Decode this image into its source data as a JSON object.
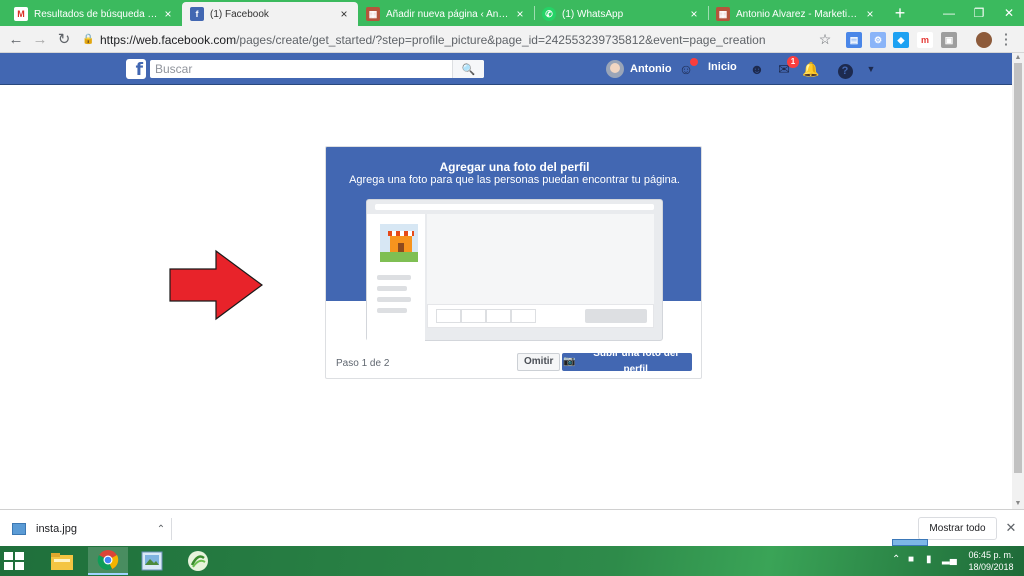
{
  "browser": {
    "tabs": [
      {
        "title": "Resultados de búsqueda - antonio",
        "favicon": "gmail-icon",
        "active": false
      },
      {
        "title": "(1) Facebook",
        "favicon": "facebook-icon",
        "active": true
      },
      {
        "title": "Añadir nueva página ‹ Antonio A",
        "favicon": "wordpress-icon",
        "active": false
      },
      {
        "title": "(1) WhatsApp",
        "favicon": "whatsapp-icon",
        "active": false
      },
      {
        "title": "Antonio Alvarez - Marketing Dig",
        "favicon": "site-icon",
        "active": false
      }
    ],
    "close_glyph": "×",
    "new_tab_glyph": "+",
    "address": {
      "domain": "https://web.facebook.com",
      "path": "/pages/create/get_started/?step=profile_picture&page_id=242553239735812&event=page_creation"
    }
  },
  "facebook": {
    "logo": "f",
    "search_placeholder": "Buscar",
    "user_name": "Antonio",
    "home_label": "Inicio",
    "messages_badge": "1",
    "brand_color": "#4267b2"
  },
  "dialog": {
    "title": "Agregar una foto del perfil",
    "subtitle": "Agrega una foto para que las personas puedan encontrar tu página.",
    "step_label": "Paso 1 de 2",
    "skip_label": "Omitir",
    "upload_label": "Subir una foto del perfil"
  },
  "downloads": {
    "file_name": "insta.jpg",
    "show_all_label": "Mostrar todo"
  },
  "taskbar": {
    "time": "06:45 p. m.",
    "date": "18/09/2018"
  }
}
